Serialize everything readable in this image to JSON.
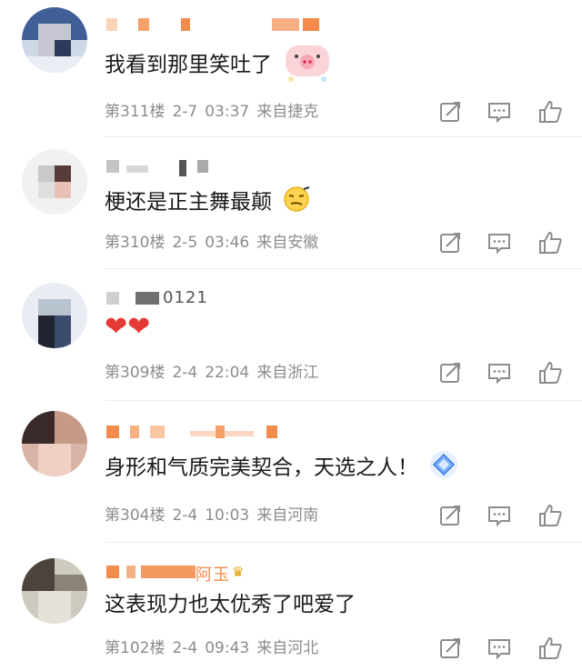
{
  "comments": [
    {
      "username": "",
      "text": "我看到那里笑吐了",
      "floor": "第311楼",
      "date": "2-7",
      "time": "03:37",
      "location": "来自捷克",
      "emoji": "pig-emoji"
    },
    {
      "username": "",
      "text": "梗还是正主舞最颠",
      "floor": "第310楼",
      "date": "2-5",
      "time": "03:46",
      "location": "来自安徽",
      "emoji": "smirk-emoji"
    },
    {
      "username": "0121",
      "text": "❤❤",
      "floor": "第309楼",
      "date": "2-4",
      "time": "22:04",
      "location": "来自浙江",
      "emoji": "heart-emoji"
    },
    {
      "username": "",
      "text": "身形和气质完美契合，天选之人！",
      "floor": "第304楼",
      "date": "2-4",
      "time": "10:03",
      "location": "来自河南",
      "emoji": "diamond-badge"
    },
    {
      "username": "阿玉",
      "text": "这表现力也太优秀了吧爱了",
      "floor": "第102楼",
      "date": "2-4",
      "time": "09:43",
      "location": "来自河北",
      "emoji": "crown-icon"
    }
  ],
  "icons": {
    "share": "share-icon",
    "reply": "comment-icon",
    "like": "like-icon"
  },
  "colors": {
    "text": "#1a1a1a",
    "meta": "#8c8c8c",
    "heart": "#e53935",
    "username_block": "#f5a66b"
  }
}
